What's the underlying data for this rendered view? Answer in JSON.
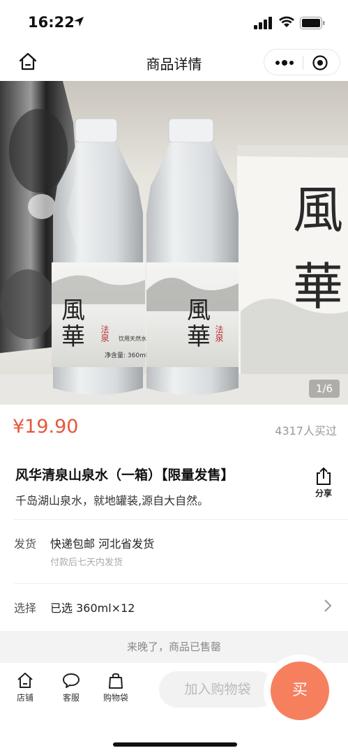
{
  "status_bar": {
    "time": "16:22"
  },
  "nav": {
    "title": "商品详情",
    "home_icon": "home-icon",
    "more_icon": "more-icon",
    "close_icon": "target-close-icon"
  },
  "gallery": {
    "counter": "1/6",
    "bottle_brand": "風華",
    "bottle_sub": "法泉",
    "bottle_type": "饮用天然水",
    "bottle_volume": "净含量: 360ml",
    "box_brand": "風華"
  },
  "product": {
    "price": "¥19.90",
    "sold_count": "4317人买过",
    "title": "风华清泉山泉水（一箱）【限量发售】",
    "subtitle": "千岛湖山泉水，就地罐装,源自大自然。",
    "share_label": "分享"
  },
  "shipping": {
    "label": "发货",
    "value": "快递包邮 河北省发货",
    "note": "付款后七天内发货"
  },
  "selection": {
    "label": "选择",
    "value": "已选 360ml×12"
  },
  "soldout_text": "来晚了，商品已售罄",
  "bottom_bar": {
    "tabs": [
      {
        "label": "店铺",
        "icon": "store-icon"
      },
      {
        "label": "客服",
        "icon": "chat-icon"
      },
      {
        "label": "购物袋",
        "icon": "bag-icon"
      }
    ],
    "cart_label": "加入购物袋",
    "buy_label": "买"
  },
  "colors": {
    "accent": "#e4583b",
    "buy_button": "#f6805e"
  }
}
